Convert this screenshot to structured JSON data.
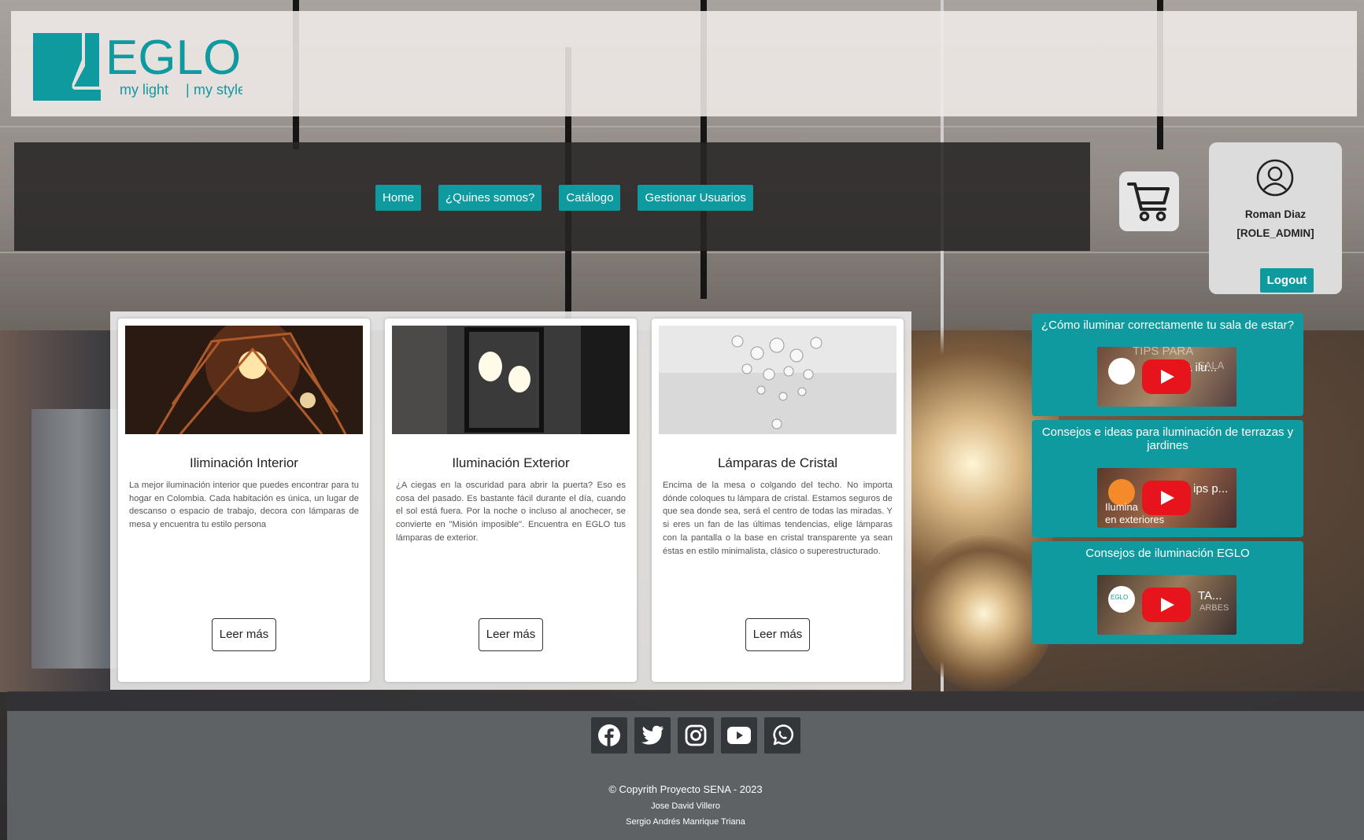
{
  "brand": {
    "name": "EGLO",
    "tagline_a": "my light",
    "tagline_b": "my style",
    "color": "#0f9aa0"
  },
  "nav": {
    "items": [
      {
        "label": "Home"
      },
      {
        "label": "¿Quines somos?"
      },
      {
        "label": "Catálogo"
      },
      {
        "label": "Gestionar Usuarios"
      }
    ]
  },
  "cart": {
    "icon": "shopping-cart-icon"
  },
  "user": {
    "name": "Roman Diaz",
    "role": "[ROLE_ADMIN]",
    "logout_label": "Logout",
    "icon": "user-avatar-icon"
  },
  "cards": [
    {
      "title": "Iliminación Interior",
      "text": "La mejor iluminación interior que puedes encontrar para tu hogar en Colombia. Cada habitación es única, un lugar de descanso o espacio de trabajo, decora con lámparas de mesa y encuentra tu estilo persona",
      "button": "Leer más"
    },
    {
      "title": "Iluminación Exterior",
      "text": "¿A ciegas en la oscuridad para abrir la puerta? Eso es cosa del pasado. Es bastante fácil durante el día, cuando el sol está fuera. Por la noche o incluso al anochecer, se convierte en \"Misión imposible\". Encuentra en EGLO tus lámparas de exterior.",
      "button": "Leer más"
    },
    {
      "title": "Lámparas de Cristal",
      "text": "Encima de la mesa o colgando del techo. No importa dónde coloques tu lámpara de cristal. Estamos seguros de que sea donde sea, será el centro de todas las miradas. Y si eres un fan de las últimas tendencias, elige lámparas con la pantalla o la base en cristal transparente ya sean éstas en estilo minimalista, clásico o superestructurado.",
      "button": "Leer más"
    }
  ],
  "videos": [
    {
      "title": "¿Cómo iluminar correctamente tu sala de estar?",
      "thumb_text": "TIPS PARA",
      "thumb_text2": "a ilu...",
      "thumb_text3": "SALA"
    },
    {
      "title": "Consejos e ideas para iluminación de terrazas y jardines",
      "thumb_text": "ips p...",
      "thumb_text2": "Ilumina",
      "thumb_text3": "en exteriores"
    },
    {
      "title": "Consejos de iluminación EGLO",
      "thumb_text": "TA...",
      "thumb_text2": "ARBES",
      "thumb_text3": "EGLO"
    }
  ],
  "footer": {
    "socials": [
      "facebook-icon",
      "twitter-icon",
      "instagram-icon",
      "youtube-icon",
      "whatsapp-icon"
    ],
    "copyright": "© Copyrith Proyecto SENA - 2023",
    "authors": [
      "Jose David Villero",
      "Sergio Andrés Manrique Triana"
    ]
  }
}
